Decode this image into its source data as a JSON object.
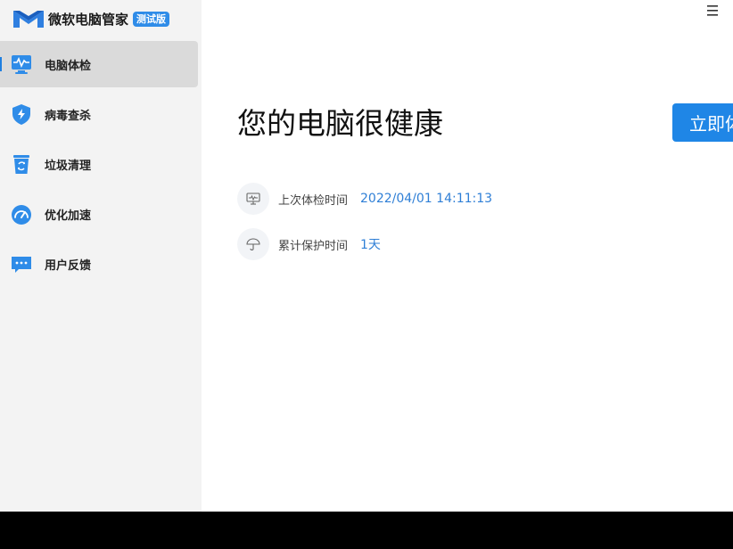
{
  "app": {
    "name": "微软电脑管家",
    "badge": "测试版"
  },
  "colors": {
    "accent": "#1f86e6",
    "sidebar_bg": "#f3f3f3",
    "active_item_bg": "#dadada",
    "value_text": "#2f7fd6"
  },
  "sidebar": {
    "items": [
      {
        "label": "电脑体检",
        "icon": "health-check-icon",
        "active": true
      },
      {
        "label": "病毒查杀",
        "icon": "shield-icon",
        "active": false
      },
      {
        "label": "垃圾清理",
        "icon": "recycle-bin-icon",
        "active": false
      },
      {
        "label": "优化加速",
        "icon": "speedometer-icon",
        "active": false
      },
      {
        "label": "用户反馈",
        "icon": "feedback-chat-icon",
        "active": false
      }
    ]
  },
  "main": {
    "menu_icon": "hamburger-menu-icon",
    "headline": "您的电脑很健康",
    "scan_button_label": "立即体检",
    "info": [
      {
        "icon": "monitor-icon",
        "label": "上次体检时间",
        "value": "2022/04/01 14:11:13"
      },
      {
        "icon": "umbrella-icon",
        "label": "累计保护时间",
        "value": "1天"
      }
    ]
  }
}
